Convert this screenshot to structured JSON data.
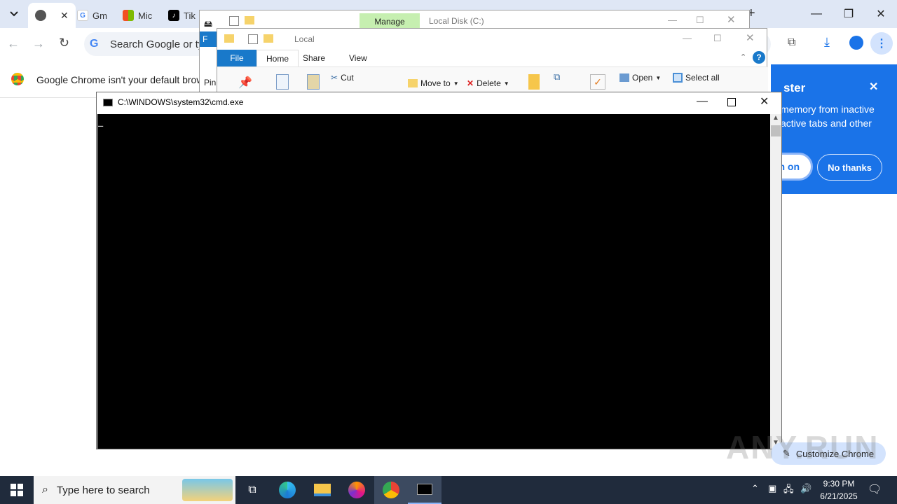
{
  "chrome": {
    "tabs": [
      {
        "label": ""
      },
      {
        "label": "Gm"
      },
      {
        "label": "Mic"
      },
      {
        "label": "Tik"
      }
    ],
    "new_tab": "+",
    "omnibox_placeholder": "Search Google or typ",
    "infobar_text": "Google Chrome isn't your default browse",
    "customize_label": "Customize Chrome",
    "popup": {
      "title_fragment": "ster",
      "body_line1": "memory from inactive",
      "body_line2": "active tabs and other",
      "turn_on_label": "n on",
      "no_thanks_label": "No thanks",
      "close": "✕"
    }
  },
  "explorer_back": {
    "manage_label": "Manage",
    "title": "Local Disk (C:)",
    "file_label": "F",
    "pin_label": "Pin"
  },
  "explorer_front": {
    "title": "Local",
    "tabs": [
      "File",
      "Home",
      "Share",
      "View"
    ],
    "ribbon": {
      "cut": "Cut",
      "move_to": "Move to",
      "delete": "Delete",
      "open": "Open",
      "select_all": "Select all"
    },
    "help": "?"
  },
  "cmd": {
    "title": "C:\\WINDOWS\\system32\\cmd.exe",
    "cursor": "_"
  },
  "taskbar": {
    "search_placeholder": "Type here to search",
    "time": "9:30 PM",
    "date": "6/21/2025"
  },
  "watermark": "ANY.RUN",
  "colors": {
    "chrome_blue": "#1a73e8",
    "taskbar": "#202b3c",
    "manage_green": "#c6efb0",
    "explorer_file_tab": "#1979ca"
  }
}
